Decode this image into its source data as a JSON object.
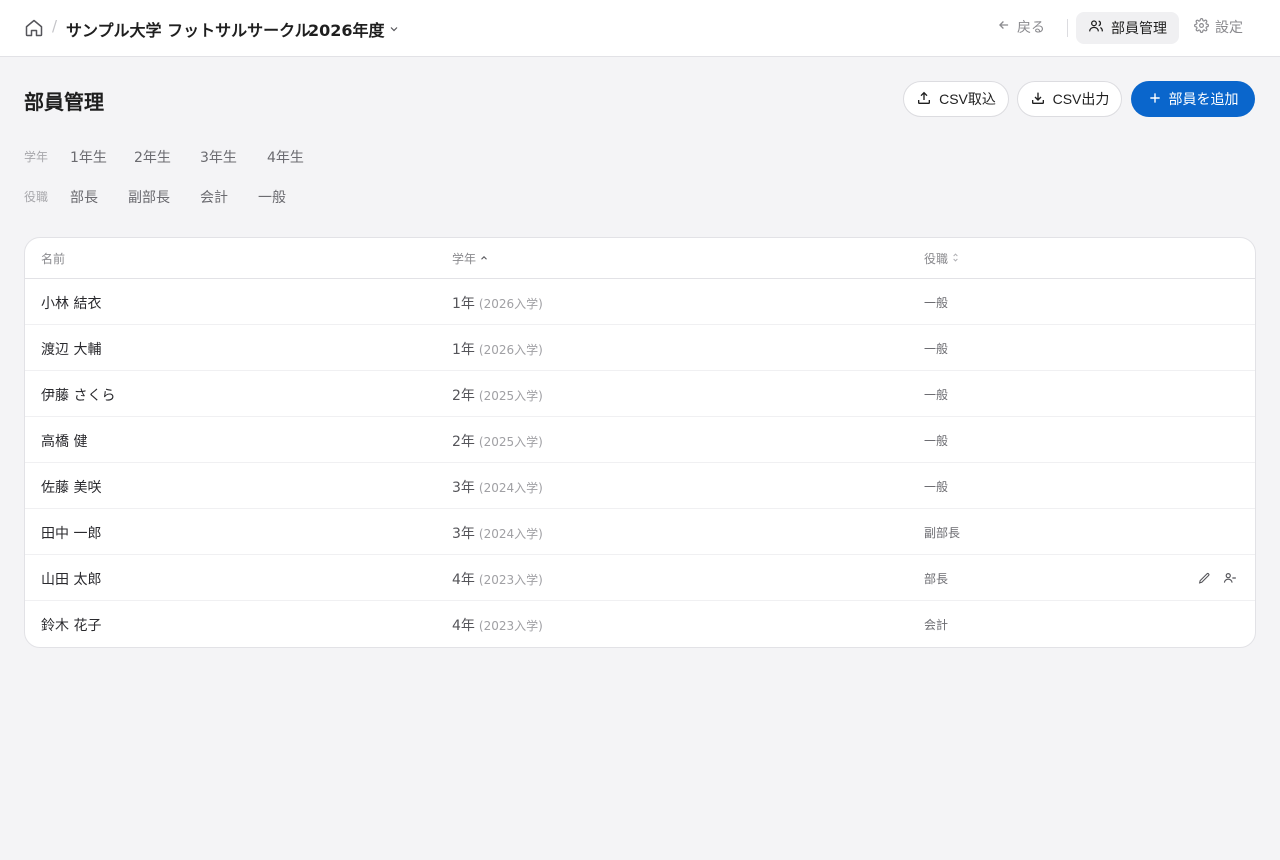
{
  "header": {
    "breadcrumb_separator": "/",
    "org_name": "サンプル大学 フットサルサークル",
    "year_label": "2026年度",
    "nav": {
      "back_label": "戻る",
      "members_label": "部員管理",
      "settings_label": "設定"
    }
  },
  "page": {
    "title": "部員管理",
    "actions": {
      "import_label": "CSV取込",
      "export_label": "CSV出力",
      "add_label": "部員を追加"
    }
  },
  "filters": {
    "grade": {
      "label": "学年",
      "options": [
        "1年生",
        "2年生",
        "3年生",
        "4年生"
      ]
    },
    "role": {
      "label": "役職",
      "options": [
        "部長",
        "副部長",
        "会計",
        "一般"
      ]
    }
  },
  "table": {
    "columns": {
      "name": "名前",
      "grade": "学年",
      "role": "役職"
    },
    "rows": [
      {
        "name": "小林 結衣",
        "grade": "1年",
        "enroll": "(2026入学)",
        "role": "一般"
      },
      {
        "name": "渡辺 大輔",
        "grade": "1年",
        "enroll": "(2026入学)",
        "role": "一般"
      },
      {
        "name": "伊藤 さくら",
        "grade": "2年",
        "enroll": "(2025入学)",
        "role": "一般"
      },
      {
        "name": "高橋 健",
        "grade": "2年",
        "enroll": "(2025入学)",
        "role": "一般"
      },
      {
        "name": "佐藤 美咲",
        "grade": "3年",
        "enroll": "(2024入学)",
        "role": "一般"
      },
      {
        "name": "田中 一郎",
        "grade": "3年",
        "enroll": "(2024入学)",
        "role": "副部長"
      },
      {
        "name": "山田 太郎",
        "grade": "4年",
        "enroll": "(2023入学)",
        "role": "部長"
      },
      {
        "name": "鈴木 花子",
        "grade": "4年",
        "enroll": "(2023入学)",
        "role": "会計"
      }
    ]
  },
  "colors": {
    "primary": "#0a66cc",
    "background": "#f4f4f6"
  }
}
